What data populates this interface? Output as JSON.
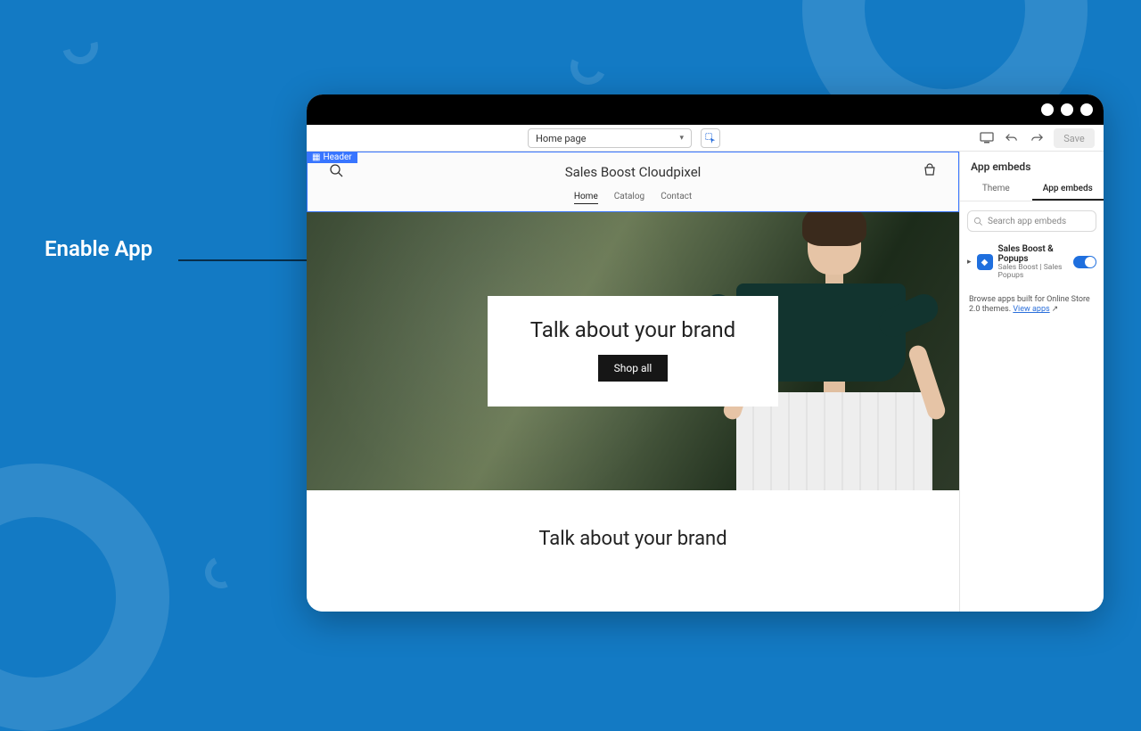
{
  "callout": {
    "label": "Enable App"
  },
  "toolbar": {
    "page_selector": "Home page",
    "save": "Save"
  },
  "store": {
    "header_tag": "Header",
    "title": "Sales Boost Cloudpixel",
    "nav": {
      "home": "Home",
      "catalog": "Catalog",
      "contact": "Contact"
    },
    "hero_heading": "Talk about your brand",
    "hero_button": "Shop all",
    "section2_heading": "Talk about your brand"
  },
  "side": {
    "heading": "App embeds",
    "tab_theme": "Theme",
    "tab_embeds": "App embeds",
    "search_placeholder": "Search app embeds",
    "app_name": "Sales Boost & Popups",
    "app_sub": "Sales Boost | Sales Popups",
    "note_pre": "Browse apps built for Online Store 2.0 themes. ",
    "note_link": "View apps"
  }
}
